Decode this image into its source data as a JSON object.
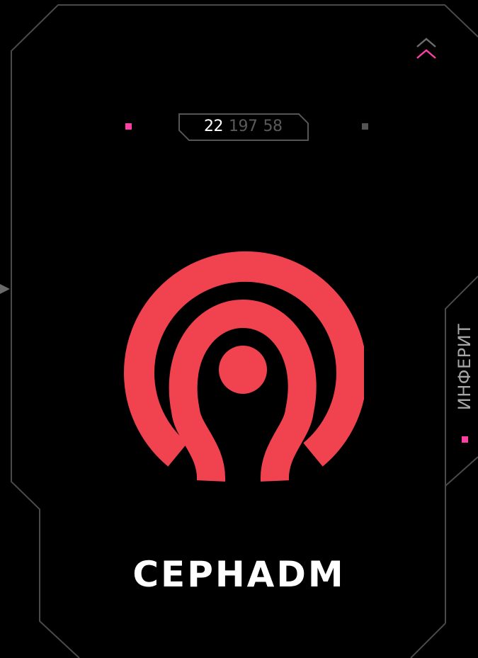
{
  "colors": {
    "accent": "#ff3fa4",
    "logo": "#f1434f",
    "frame_line": "#4a4a4a",
    "inactive_square": "#555555"
  },
  "counter": {
    "active_value": "22",
    "value_2": "197",
    "value_3": "58"
  },
  "side_tab": {
    "label": "ИНФЕРИТ"
  },
  "card": {
    "title": "CEPHADM",
    "logo_icon": "ceph-logo-icon"
  },
  "icons": {
    "scroll_up": "double-chevron-up-icon",
    "side_arrow": "triangle-right-icon"
  }
}
